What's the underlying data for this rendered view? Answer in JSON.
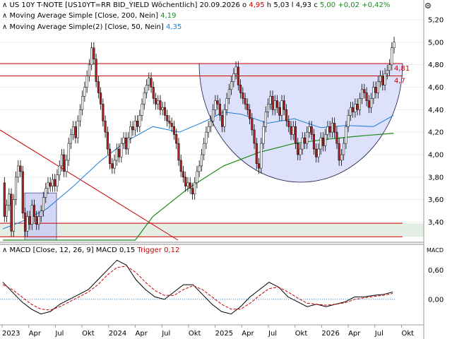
{
  "header": {
    "instrument": "US 10Y T-NOTE [US10YT=RR BID_YIELD Wöchentlich]",
    "date": "20.09.2026",
    "open_label": "o",
    "open_value": "4,95",
    "high_label": "h",
    "high_value": "5,03",
    "low_label": "l",
    "low_value": "4,93",
    "close_label": "c",
    "close_value": "5,00",
    "change": "+0,02",
    "change_pct": "+0,42%"
  },
  "indicators": [
    {
      "text": "Moving Average Simple [Close, 200, Nein]",
      "value": "4,19"
    },
    {
      "text": "Moving Average Simple(2) [Close, 50, Nein]",
      "value": "4,35"
    }
  ],
  "macd_label": {
    "text": "MACD [Close, 12, 26, 9]",
    "macd": "MACD 0,15",
    "trigger": "Trigger 0,12"
  },
  "macd_axis_title": "MACD",
  "colors": {
    "up": "#ffffff",
    "down": "#b22222",
    "candle_border": "#000000",
    "ma200": "#1a8a1a",
    "ma50": "#1a7fd4",
    "hline": "#cc0000",
    "circle_fill": "#d8dcfa",
    "box_fill": "#c8ccf4",
    "support_fill": "#e4eee4",
    "macd": "#000000",
    "trigger": "#cc0000",
    "zero_line": "#1a7fd4"
  },
  "chart_data": {
    "type": "candlestick",
    "title": "US 10Y T-NOTE [US10YT=RR BID_YIELD Wöchentlich]",
    "y_ticks": [
      "5,20",
      "5,00",
      "4,80",
      "4,60",
      "4,40",
      "4,20",
      "4,00",
      "3,80",
      "3,60",
      "3,40"
    ],
    "x_ticks": [
      "2023",
      "Apr",
      "Jul",
      "Okt",
      "2024",
      "Apr",
      "Jul",
      "Okt",
      "2025",
      "Apr",
      "Jul",
      "Okt",
      "2026",
      "Apr",
      "Jul",
      "Okt"
    ],
    "ylim": [
      3.24,
      5.25
    ],
    "weeks_total": 208,
    "candles": [
      [
        3.75,
        3.45
      ],
      [
        3.45,
        3.55
      ],
      [
        3.55,
        3.65
      ],
      [
        3.65,
        3.32
      ],
      [
        3.32,
        3.6
      ],
      [
        3.6,
        3.8
      ],
      [
        3.8,
        3.9
      ],
      [
        3.9,
        3.85
      ],
      [
        3.85,
        3.48
      ],
      [
        3.48,
        3.32
      ],
      [
        3.32,
        3.45
      ],
      [
        3.45,
        3.38
      ],
      [
        3.38,
        3.55
      ],
      [
        3.55,
        3.45
      ],
      [
        3.45,
        3.38
      ],
      [
        3.38,
        3.45
      ],
      [
        3.45,
        3.5
      ],
      [
        3.5,
        3.62
      ],
      [
        3.62,
        3.7
      ],
      [
        3.7,
        3.75
      ],
      [
        3.75,
        3.72
      ],
      [
        3.72,
        3.78
      ],
      [
        3.78,
        3.72
      ],
      [
        3.72,
        3.82
      ],
      [
        3.82,
        3.9
      ],
      [
        3.9,
        4.0
      ],
      [
        4.0,
        3.85
      ],
      [
        3.85,
        3.95
      ],
      [
        3.95,
        4.1
      ],
      [
        4.1,
        4.18
      ],
      [
        4.18,
        4.25
      ],
      [
        4.25,
        4.15
      ],
      [
        4.15,
        4.3
      ],
      [
        4.3,
        4.4
      ],
      [
        4.4,
        4.52
      ],
      [
        4.52,
        4.6
      ],
      [
        4.6,
        4.7
      ],
      [
        4.7,
        4.8
      ],
      [
        4.8,
        4.95
      ],
      [
        4.95,
        4.85
      ],
      [
        4.85,
        4.65
      ],
      [
        4.65,
        4.55
      ],
      [
        4.55,
        4.45
      ],
      [
        4.45,
        4.3
      ],
      [
        4.3,
        4.2
      ],
      [
        4.2,
        4.05
      ],
      [
        4.05,
        3.92
      ],
      [
        3.92,
        3.88
      ],
      [
        3.88,
        3.95
      ],
      [
        3.95,
        4.05
      ],
      [
        4.05,
        3.98
      ],
      [
        3.98,
        4.1
      ],
      [
        4.1,
        4.15
      ],
      [
        4.15,
        4.05
      ],
      [
        4.05,
        4.15
      ],
      [
        4.15,
        4.25
      ],
      [
        4.25,
        4.22
      ],
      [
        4.22,
        4.3
      ],
      [
        4.3,
        4.25
      ],
      [
        4.25,
        4.35
      ],
      [
        4.35,
        4.45
      ],
      [
        4.45,
        4.55
      ],
      [
        4.55,
        4.62
      ],
      [
        4.62,
        4.68
      ],
      [
        4.68,
        4.6
      ],
      [
        4.6,
        4.5
      ],
      [
        4.5,
        4.45
      ],
      [
        4.45,
        4.48
      ],
      [
        4.48,
        4.4
      ],
      [
        4.4,
        4.42
      ],
      [
        4.42,
        4.35
      ],
      [
        4.35,
        4.3
      ],
      [
        4.3,
        4.28
      ],
      [
        4.28,
        4.25
      ],
      [
        4.25,
        4.18
      ],
      [
        4.18,
        4.1
      ],
      [
        4.1,
        3.95
      ],
      [
        3.95,
        3.85
      ],
      [
        3.85,
        3.8
      ],
      [
        3.8,
        3.72
      ],
      [
        3.72,
        3.75
      ],
      [
        3.75,
        3.7
      ],
      [
        3.7,
        3.65
      ],
      [
        3.65,
        3.75
      ],
      [
        3.75,
        3.85
      ],
      [
        3.85,
        3.9
      ],
      [
        3.9,
        4.0
      ],
      [
        4.0,
        4.1
      ],
      [
        4.1,
        4.2
      ],
      [
        4.2,
        4.25
      ],
      [
        4.25,
        4.3
      ],
      [
        4.3,
        4.4
      ],
      [
        4.4,
        4.48
      ],
      [
        4.48,
        4.45
      ],
      [
        4.45,
        4.35
      ],
      [
        4.35,
        4.25
      ],
      [
        4.25,
        4.4
      ],
      [
        4.4,
        4.5
      ],
      [
        4.5,
        4.58
      ],
      [
        4.58,
        4.65
      ],
      [
        4.65,
        4.72
      ],
      [
        4.72,
        4.78
      ],
      [
        4.78,
        4.62
      ],
      [
        4.62,
        4.55
      ],
      [
        4.55,
        4.5
      ],
      [
        4.5,
        4.45
      ],
      [
        4.45,
        4.4
      ],
      [
        4.4,
        4.32
      ],
      [
        4.32,
        4.22
      ],
      [
        4.22,
        4.1
      ],
      [
        4.1,
        3.92
      ],
      [
        3.92,
        3.88
      ],
      [
        3.88,
        4.1
      ],
      [
        4.1,
        4.25
      ],
      [
        4.25,
        4.38
      ],
      [
        4.38,
        4.45
      ],
      [
        4.45,
        4.52
      ],
      [
        4.52,
        4.4
      ],
      [
        4.4,
        4.48
      ],
      [
        4.48,
        4.42
      ],
      [
        4.42,
        4.35
      ],
      [
        4.35,
        4.48
      ],
      [
        4.48,
        4.4
      ],
      [
        4.4,
        4.3
      ],
      [
        4.3,
        4.25
      ],
      [
        4.25,
        4.18
      ],
      [
        4.18,
        4.25
      ],
      [
        4.25,
        4.1
      ],
      [
        4.1,
        4.0
      ],
      [
        4.0,
        4.05
      ],
      [
        4.05,
        4.15
      ],
      [
        4.15,
        4.1
      ],
      [
        4.1,
        4.2
      ],
      [
        4.2,
        4.25
      ],
      [
        4.25,
        4.18
      ],
      [
        4.18,
        4.05
      ],
      [
        4.05,
        3.98
      ],
      [
        3.98,
        4.05
      ],
      [
        4.05,
        4.15
      ],
      [
        4.15,
        4.08
      ],
      [
        4.08,
        4.18
      ],
      [
        4.18,
        4.25
      ],
      [
        4.25,
        4.2
      ],
      [
        4.2,
        4.28
      ],
      [
        4.28,
        4.2
      ],
      [
        4.2,
        4.1
      ],
      [
        4.1,
        3.95
      ],
      [
        3.95,
        4.0
      ],
      [
        4.0,
        4.1
      ],
      [
        4.1,
        4.25
      ],
      [
        4.25,
        4.35
      ],
      [
        4.35,
        4.42
      ],
      [
        4.42,
        4.38
      ],
      [
        4.38,
        4.45
      ],
      [
        4.45,
        4.4
      ],
      [
        4.4,
        4.5
      ],
      [
        4.5,
        4.58
      ],
      [
        4.58,
        4.55
      ],
      [
        4.55,
        4.48
      ],
      [
        4.48,
        4.42
      ],
      [
        4.42,
        4.5
      ],
      [
        4.5,
        4.6
      ],
      [
        4.6,
        4.55
      ],
      [
        4.55,
        4.65
      ],
      [
        4.65,
        4.7
      ],
      [
        4.7,
        4.62
      ],
      [
        4.62,
        4.72
      ],
      [
        4.72,
        4.75
      ],
      [
        4.75,
        4.8
      ],
      [
        4.8,
        4.95
      ],
      [
        4.95,
        5.0
      ]
    ],
    "ma200": [
      [
        0,
        3.24
      ],
      [
        0.3,
        3.24
      ],
      [
        0.34,
        3.45
      ],
      [
        0.42,
        3.7
      ],
      [
        0.5,
        3.9
      ],
      [
        0.58,
        4.02
      ],
      [
        0.66,
        4.1
      ],
      [
        0.74,
        4.14
      ],
      [
        0.82,
        4.17
      ],
      [
        0.885,
        4.19
      ]
    ],
    "ma50": [
      [
        0,
        3.34
      ],
      [
        0.04,
        3.4
      ],
      [
        0.1,
        3.52
      ],
      [
        0.16,
        3.72
      ],
      [
        0.22,
        3.94
      ],
      [
        0.28,
        4.12
      ],
      [
        0.34,
        4.25
      ],
      [
        0.4,
        4.2
      ],
      [
        0.46,
        4.3
      ],
      [
        0.5,
        4.38
      ],
      [
        0.54,
        4.36
      ],
      [
        0.6,
        4.28
      ],
      [
        0.66,
        4.32
      ],
      [
        0.72,
        4.24
      ],
      [
        0.78,
        4.26
      ],
      [
        0.84,
        4.25
      ],
      [
        0.885,
        4.35
      ]
    ],
    "hlines": [
      4.81,
      4.7,
      3.39,
      3.27
    ],
    "hline_labels": [
      "4,81",
      "4,7"
    ],
    "macd_ticks": [
      "0,60",
      "0,00"
    ],
    "macd_range": [
      -0.45,
      0.85
    ],
    "macd_series": [
      0.35,
      0.15,
      -0.05,
      -0.2,
      -0.3,
      -0.25,
      -0.1,
      0.0,
      0.1,
      0.2,
      0.4,
      0.6,
      0.8,
      0.7,
      0.4,
      0.2,
      0.05,
      0.0,
      0.15,
      0.3,
      0.3,
      0.1,
      -0.1,
      -0.25,
      -0.3,
      -0.15,
      0.05,
      0.2,
      0.35,
      0.25,
      0.05,
      -0.05,
      -0.15,
      -0.1,
      -0.15,
      -0.1,
      -0.05,
      0.05,
      0.05,
      0.08,
      0.1,
      0.15
    ],
    "trigger_series": [
      0.3,
      0.2,
      0.05,
      -0.1,
      -0.2,
      -0.22,
      -0.15,
      -0.05,
      0.05,
      0.15,
      0.3,
      0.5,
      0.65,
      0.68,
      0.55,
      0.35,
      0.18,
      0.08,
      0.08,
      0.2,
      0.28,
      0.2,
      0.05,
      -0.1,
      -0.2,
      -0.2,
      -0.08,
      0.08,
      0.22,
      0.25,
      0.15,
      0.03,
      -0.08,
      -0.1,
      -0.12,
      -0.1,
      -0.07,
      0.0,
      0.03,
      0.06,
      0.08,
      0.12
    ]
  }
}
